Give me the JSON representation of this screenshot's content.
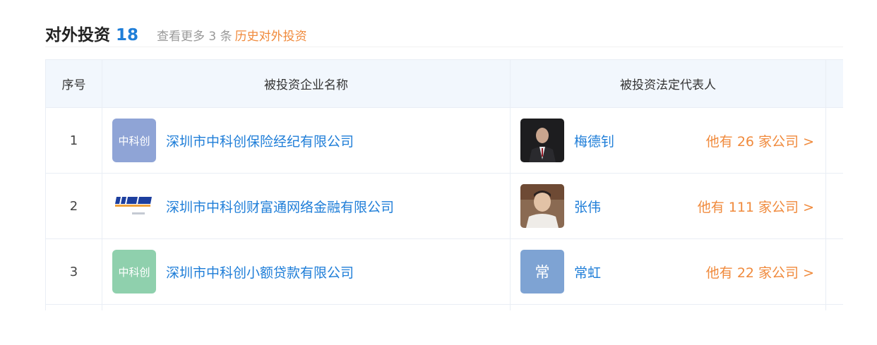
{
  "section": {
    "title": "对外投资",
    "count": "18",
    "more_prefix": "查看更多 3 条",
    "history_link": "历史对外投资"
  },
  "table": {
    "headers": [
      "序号",
      "被投资企业名称",
      "被投资法定代表人"
    ],
    "rows": [
      {
        "index": "1",
        "logo_text": "中科创",
        "company": "深圳市中科创保险经纪有限公司",
        "person": "梅德钊",
        "company_count": "他有 26 家公司 >"
      },
      {
        "index": "2",
        "logo_text": "",
        "company": "深圳市中科创财富通网络金融有限公司",
        "person": "张伟",
        "company_count": "他有 111 家公司 >"
      },
      {
        "index": "3",
        "logo_text": "中科创",
        "avatar_letter": "常",
        "company": "深圳市中科创小额贷款有限公司",
        "person": "常虹",
        "company_count": "他有 22 家公司 >"
      }
    ]
  },
  "colors": {
    "accent_blue": "#1f7ed8",
    "accent_orange": "#f08a3c",
    "header_bg": "#f2f7fd"
  }
}
